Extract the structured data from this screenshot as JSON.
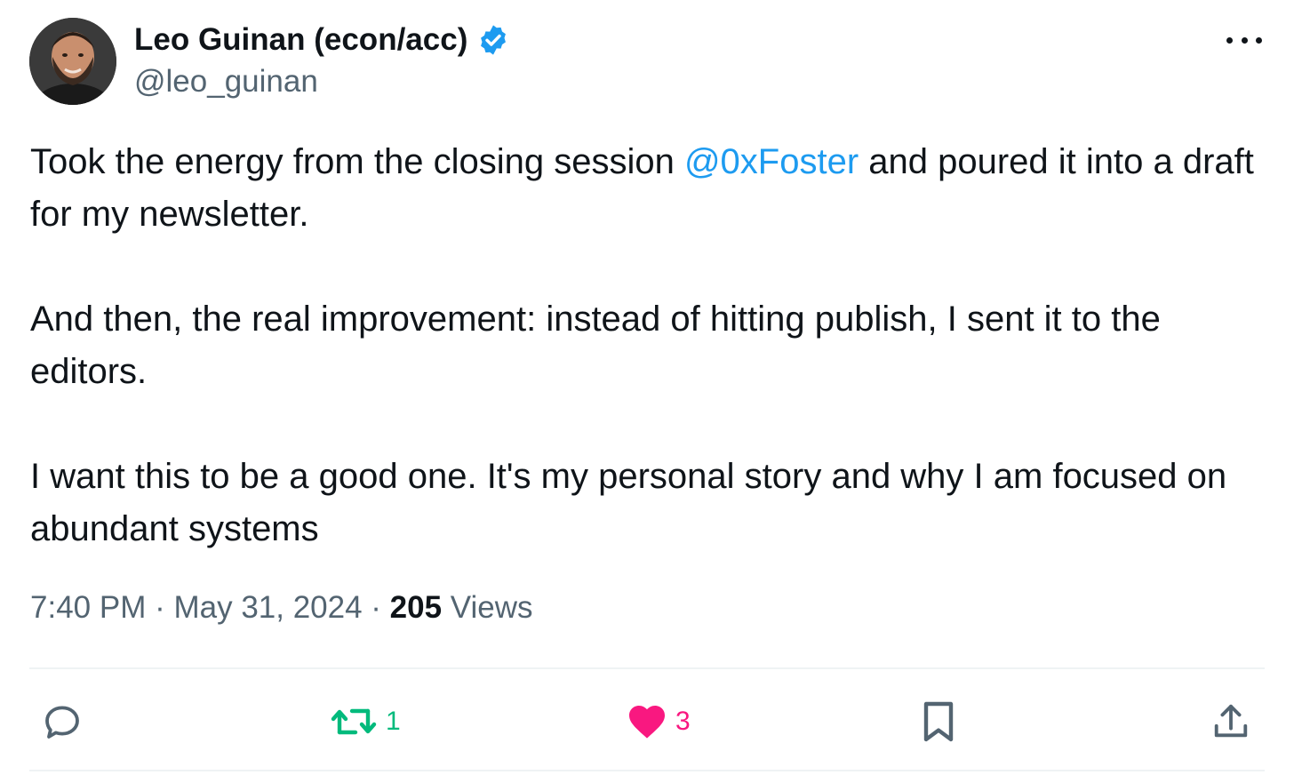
{
  "author": {
    "display_name": "Leo Guinan (econ/acc)",
    "handle": "@leo_guinan",
    "verified": true
  },
  "tweet": {
    "paragraphs": [
      {
        "before": "Took the energy from the closing session ",
        "mention": "@0xFoster",
        "after": " and poured it into a draft for my newsletter."
      },
      "And then, the real improvement: instead of hitting publish, I sent it to the editors.",
      "I want this to be a good one. It's my personal story and why I am focused on abundant systems"
    ],
    "time": "7:40 PM",
    "separator": " · ",
    "date": "May 31, 2024",
    "views_count": "205",
    "views_label": " Views"
  },
  "actions": {
    "reply_icon": "reply-icon",
    "retweet_icon": "retweet-icon",
    "retweet_count": "1",
    "like_icon": "heart-icon",
    "like_count": "3",
    "bookmark_icon": "bookmark-icon",
    "share_icon": "share-icon"
  },
  "colors": {
    "text": "#0f1419",
    "secondary": "#536471",
    "link": "#1d9bf0",
    "verified": "#1d9bf0",
    "retweet": "#00ba7c",
    "like": "#f91880",
    "divider": "#eff3f4"
  }
}
